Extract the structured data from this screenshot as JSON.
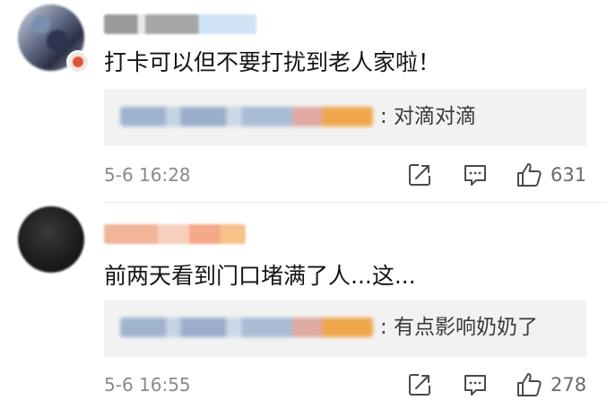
{
  "comments": [
    {
      "text": "打卡可以但不要打扰到老人家啦！",
      "reply_text": ": 对滴对滴",
      "time": "5-6 16:28",
      "likes": "631"
    },
    {
      "text": "前两天看到门口堵满了人...这...",
      "reply_text": ": 有点影响奶奶了",
      "time": "5-6 16:55",
      "likes": "278"
    }
  ],
  "icons": {
    "repost": "repost-icon",
    "reply": "comment-icon",
    "like": "thumbs-up-icon"
  },
  "colors": {
    "text": "#141414",
    "meta": "#8a8a8a",
    "reply_bg": "#f2f2f2",
    "icon": "#4a4a4a"
  }
}
